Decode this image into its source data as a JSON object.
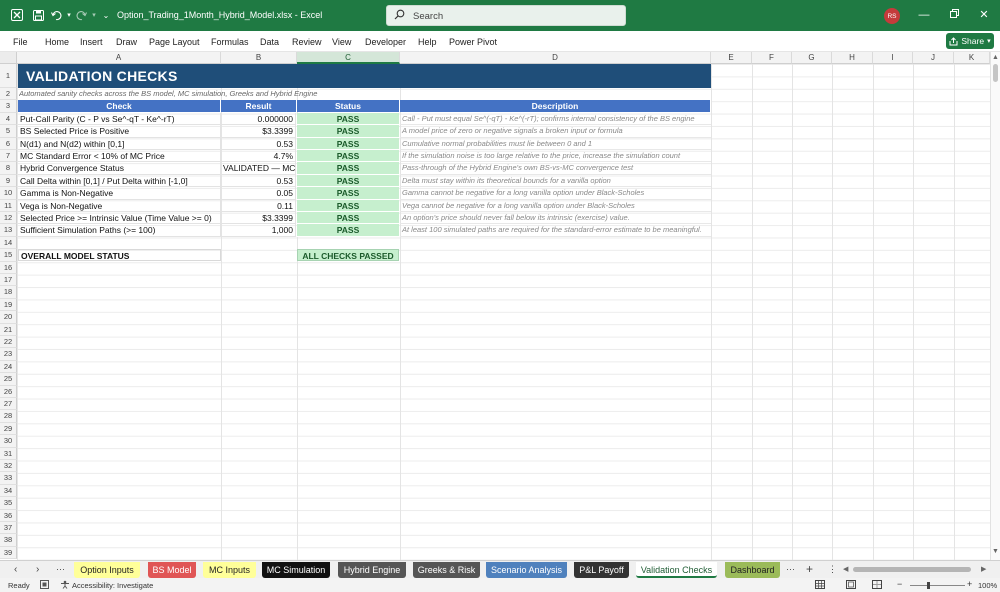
{
  "window": {
    "title": "Option_Trading_1Month_Hybrid_Model.xlsx  -  Excel",
    "search_placeholder": "Search",
    "avatar_initials": "RS",
    "app_icons": {
      "excel": "excel-icon",
      "save": "save-icon",
      "undo": "undo-icon",
      "redo": "redo-icon"
    }
  },
  "menu": {
    "items": [
      "File",
      "Home",
      "Insert",
      "Draw",
      "Page Layout",
      "Formulas",
      "Data",
      "Review",
      "View",
      "Developer",
      "Help",
      "Power Pivot"
    ],
    "share_label": "Share"
  },
  "grid": {
    "columns": [
      "A",
      "B",
      "C",
      "D",
      "E",
      "F",
      "G",
      "H",
      "I",
      "J",
      "K"
    ],
    "selected_column": "C",
    "rows": [
      "1",
      "2",
      "3",
      "4",
      "5",
      "6",
      "7",
      "8",
      "9",
      "10",
      "11",
      "12",
      "13",
      "14",
      "15",
      "16",
      "17",
      "18",
      "19",
      "20",
      "21",
      "22",
      "23",
      "24",
      "25",
      "26",
      "27",
      "28",
      "29",
      "30",
      "31",
      "32",
      "33",
      "34",
      "35",
      "36",
      "37",
      "38",
      "39"
    ]
  },
  "sheet": {
    "title": "VALIDATION CHECKS",
    "subtitle": "Automated sanity checks across the BS model, MC simulation, Greeks and Hybrid Engine",
    "headers": [
      "Check",
      "Result",
      "Status",
      "Description"
    ],
    "checks": [
      {
        "check": "Put-Call Parity  (C - P vs Se^-qT - Ke^-rT)",
        "result": "0.000000",
        "status": "PASS",
        "description": "Call - Put must equal Se^(-qT) - Ke^(-rT); confirms internal consistency of the BS engine"
      },
      {
        "check": "BS Selected Price is Positive",
        "result": "$3.3399",
        "status": "PASS",
        "description": "A model price of zero or negative signals a broken input or formula"
      },
      {
        "check": "N(d1) and N(d2) within [0,1]",
        "result": "0.53",
        "status": "PASS",
        "description": "Cumulative normal probabilities must lie between 0 and 1"
      },
      {
        "check": "MC Standard Error < 10% of MC Price",
        "result": "4.7%",
        "status": "PASS",
        "description": "If the simulation noise is too large relative to the price, increase the simulation count"
      },
      {
        "check": "Hybrid Convergence Status",
        "result": "VALIDATED — MC",
        "status": "PASS",
        "description": "Pass-through of the Hybrid Engine's own BS-vs-MC convergence test"
      },
      {
        "check": "Call Delta within [0,1] / Put Delta within [-1,0]",
        "result": "0.53",
        "status": "PASS",
        "description": "Delta must stay within its theoretical bounds for a vanilla option"
      },
      {
        "check": "Gamma is Non-Negative",
        "result": "0.05",
        "status": "PASS",
        "description": "Gamma cannot be negative for a long vanilla option under Black-Scholes"
      },
      {
        "check": "Vega is Non-Negative",
        "result": "0.11",
        "status": "PASS",
        "description": "Vega cannot be negative for a long vanilla option under Black-Scholes"
      },
      {
        "check": "Selected Price >= Intrinsic Value (Time Value >= 0)",
        "result": "$3.3399",
        "status": "PASS",
        "description": "An option's price should never fall below its intrinsic (exercise) value."
      },
      {
        "check": "Sufficient Simulation Paths (>= 100)",
        "result": "1,000",
        "status": "PASS",
        "description": "At least 100 simulated paths are required for the standard-error estimate to be meaningful."
      }
    ],
    "overall_label": "OVERALL MODEL STATUS",
    "overall_value": "ALL CHECKS PASSED",
    "colors": {
      "title_bg": "#1f4e79",
      "header_bg": "#4472c4",
      "pass_bg": "#c6efce",
      "pass_text": "#1a5a2a"
    }
  },
  "tabs": [
    {
      "label": "Option Inputs",
      "bg": "#ffff99",
      "fg": "#222222"
    },
    {
      "label": "BS Model",
      "bg": "#e05555",
      "fg": "#ffffff"
    },
    {
      "label": "MC Inputs",
      "bg": "#ffff99",
      "fg": "#222222"
    },
    {
      "label": "MC Simulation",
      "bg": "#111111",
      "fg": "#ffffff"
    },
    {
      "label": "Hybrid Engine",
      "bg": "#555555",
      "fg": "#ffffff"
    },
    {
      "label": "Greeks & Risk",
      "bg": "#555555",
      "fg": "#ffffff"
    },
    {
      "label": "Scenario Analysis",
      "bg": "#4f81bd",
      "fg": "#ffffff"
    },
    {
      "label": "P&L Payoff",
      "bg": "#333333",
      "fg": "#ffffff"
    },
    {
      "label": "Validation Checks",
      "bg": "#ffffff",
      "fg": "#1f5c34"
    },
    {
      "label": "Dashboard",
      "bg": "#9bbb59",
      "fg": "#222222"
    }
  ],
  "active_tab": "Validation Checks",
  "statusbar": {
    "ready": "Ready",
    "accessibility": "Accessibility: Investigate",
    "zoom": "100%"
  }
}
